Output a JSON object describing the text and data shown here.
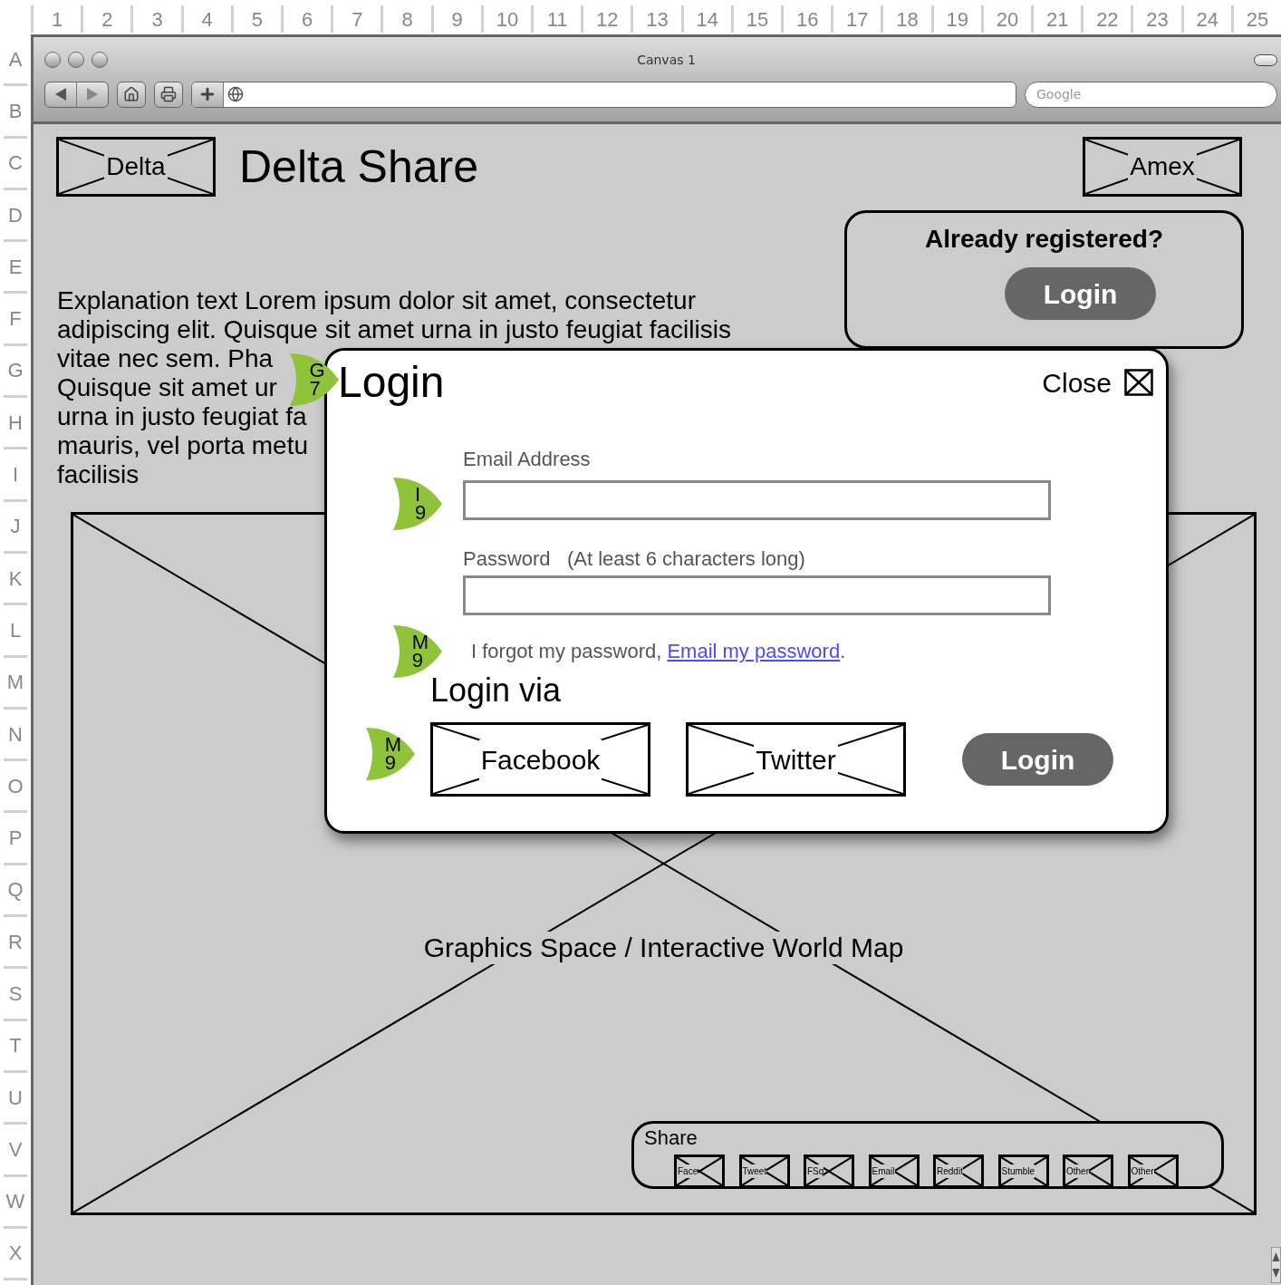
{
  "rulers": {
    "columns": [
      "1",
      "2",
      "3",
      "4",
      "5",
      "6",
      "7",
      "8",
      "9",
      "10",
      "11",
      "12",
      "13",
      "14",
      "15",
      "16",
      "17",
      "18",
      "19",
      "20",
      "21",
      "22",
      "23",
      "24",
      "25"
    ],
    "rows": [
      "A",
      "B",
      "C",
      "D",
      "E",
      "F",
      "G",
      "H",
      "I",
      "J",
      "K",
      "L",
      "M",
      "N",
      "O",
      "P",
      "Q",
      "R",
      "S",
      "T",
      "U",
      "V",
      "W",
      "X"
    ]
  },
  "window": {
    "title": "Canvas 1",
    "search_placeholder": "Google"
  },
  "header": {
    "logo": "Delta",
    "title": "Delta Share",
    "partner_logo": "Amex"
  },
  "registered_panel": {
    "heading": "Already registered?",
    "button": "Login"
  },
  "explanation_lines": [
    "Explanation text Lorem ipsum dolor sit amet, consectetur",
    "adipiscing elit. Quisque sit amet urna in justo feugiat facilisis",
    "vitae nec sem. Pha",
    "Quisque sit amet ur",
    "urna in justo feugiat fa",
    "mauris, vel porta metu",
    "facilisis"
  ],
  "map": {
    "label": "Graphics Space / Interactive World Map"
  },
  "share": {
    "title": "Share",
    "items": [
      "Face",
      "Tweet",
      "FSq",
      "Email",
      "Reddit",
      "Stumble",
      "Other",
      "Other"
    ]
  },
  "modal": {
    "title": "Login",
    "close": "Close",
    "email_label": "Email Address",
    "password_label": "Password",
    "password_hint": "(At least 6 characters long)",
    "forgot_text": "I forgot my password, ",
    "forgot_link": "Email my password",
    "forgot_end": ".",
    "via_heading": "Login via",
    "providers": [
      "Facebook",
      "Twitter"
    ],
    "submit": "Login"
  },
  "markers": [
    {
      "row": "G",
      "col": "7"
    },
    {
      "row": "I",
      "col": "9"
    },
    {
      "row": "M",
      "col": "9"
    },
    {
      "row": "M",
      "col": "9"
    }
  ]
}
